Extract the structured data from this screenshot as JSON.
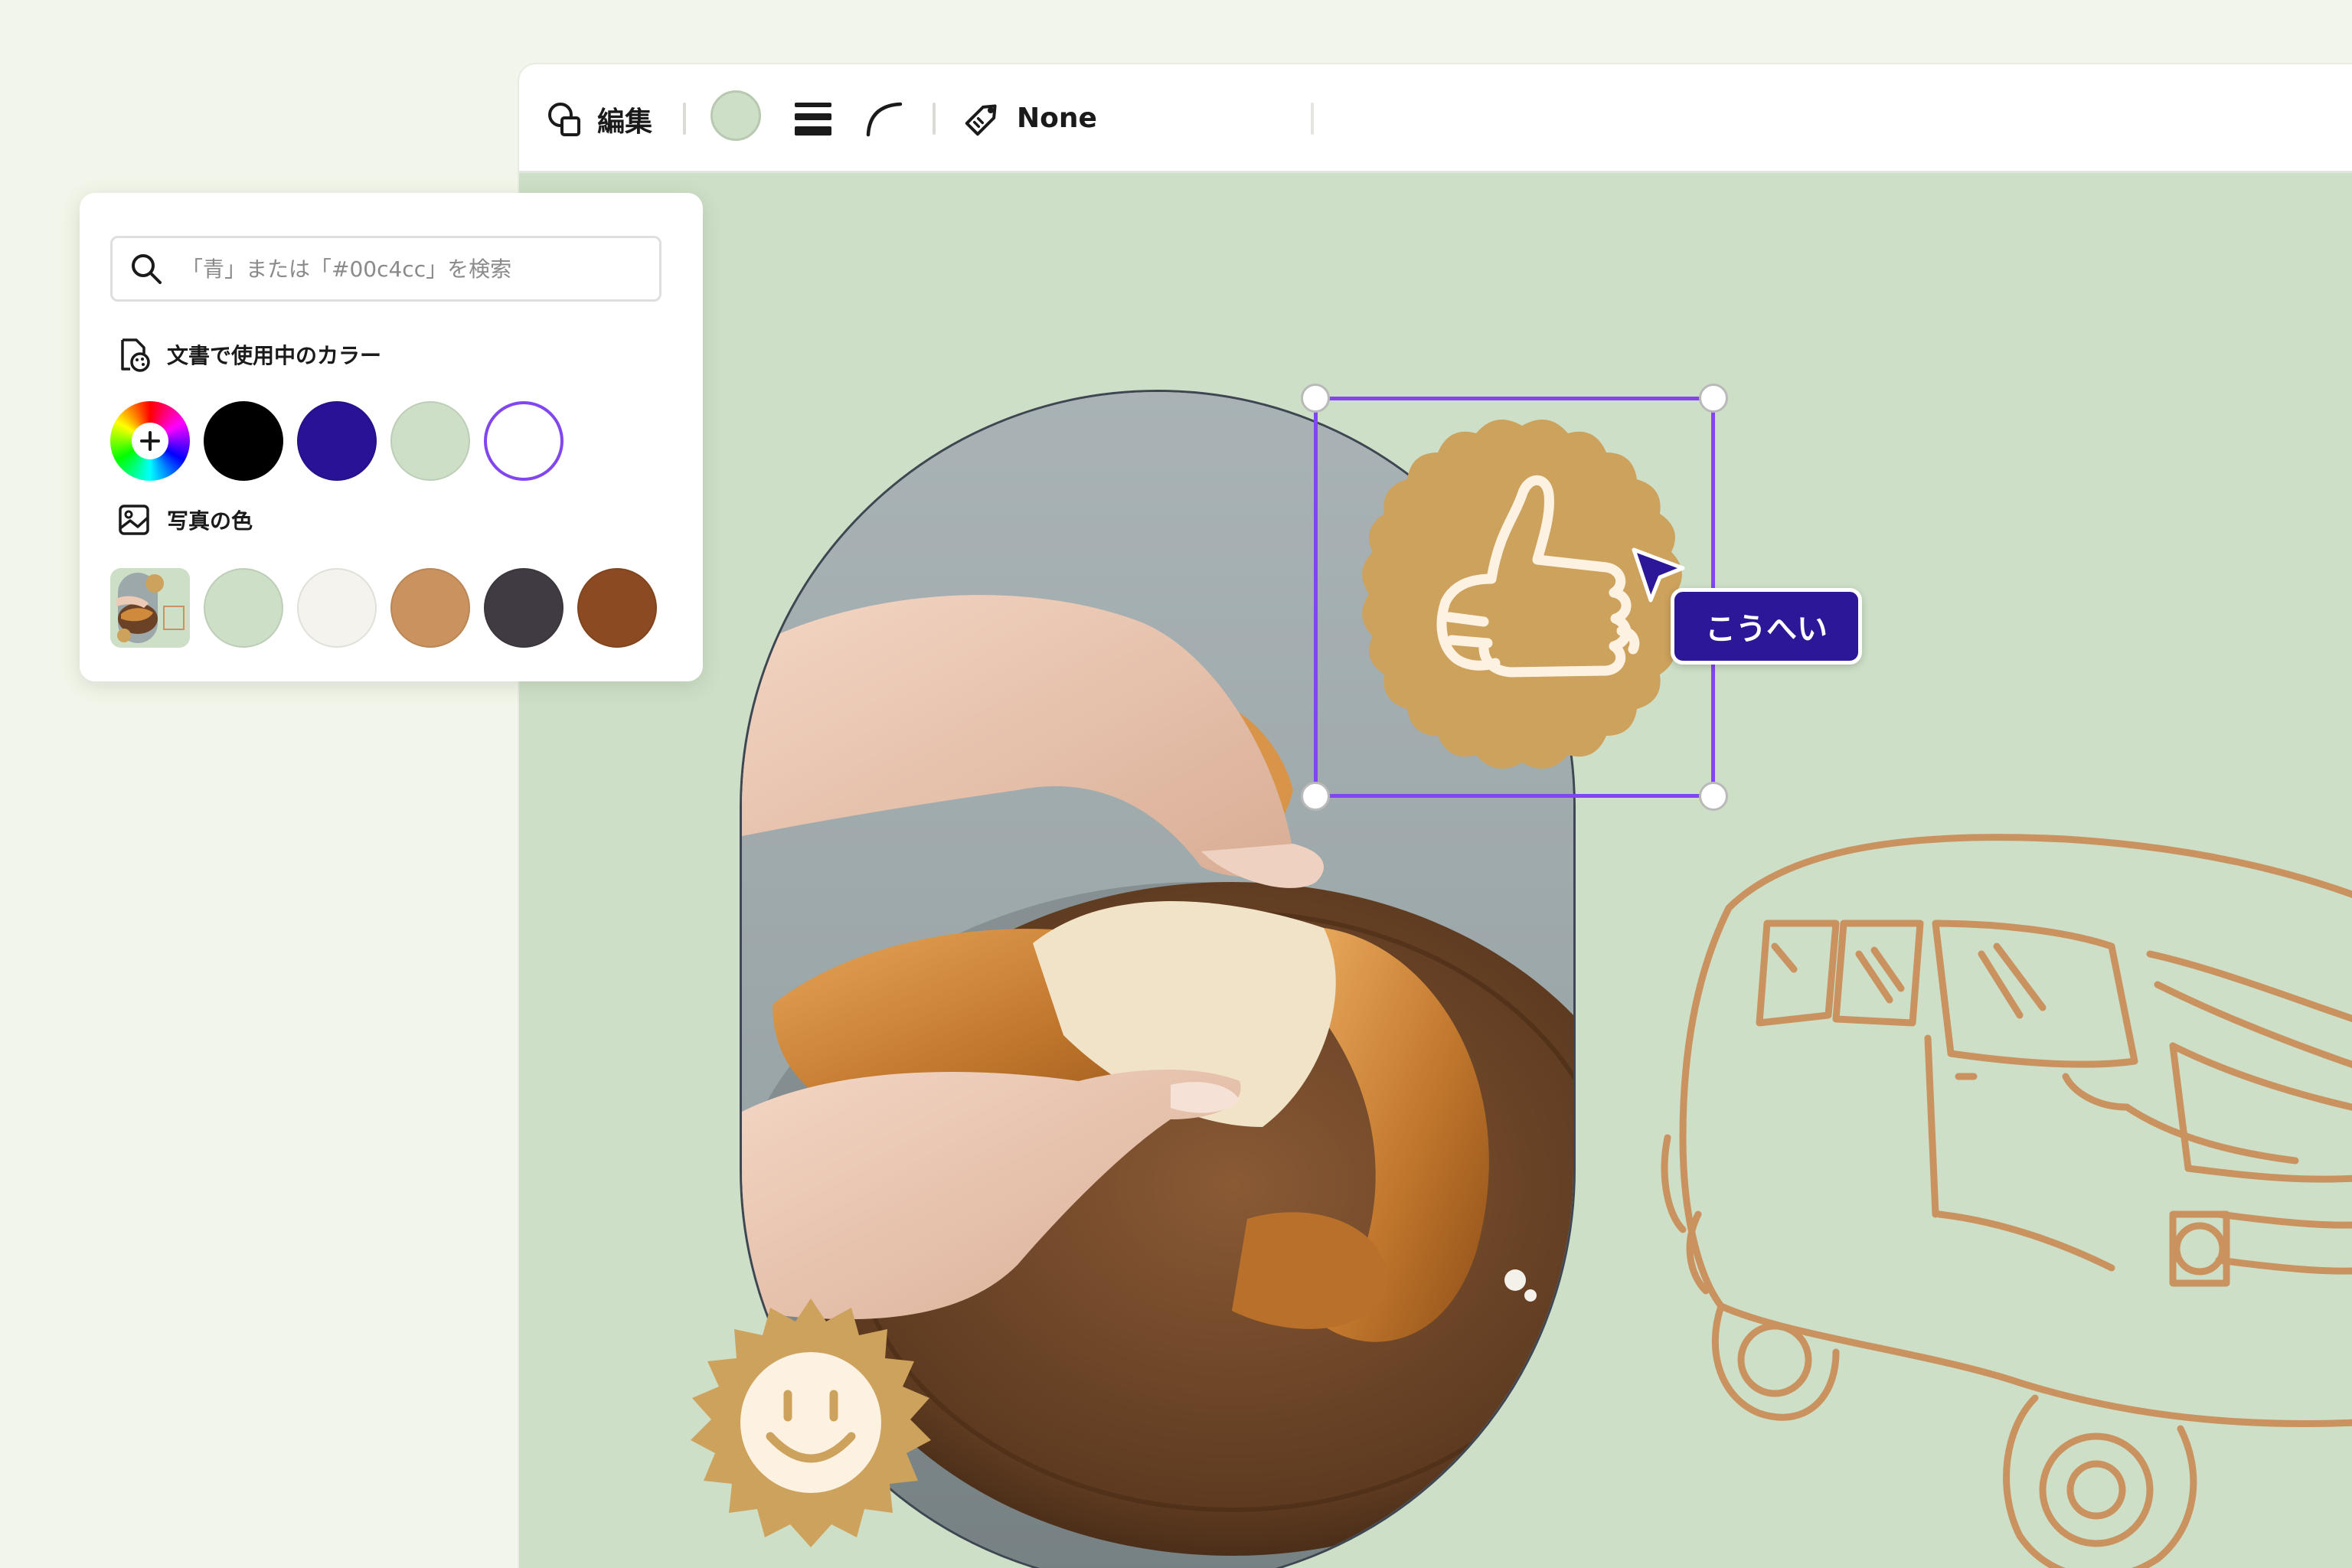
{
  "toolbar": {
    "edit_label": "編集",
    "current_color": "#cedfc7",
    "tag_label": "None"
  },
  "color_panel": {
    "search": {
      "placeholder": "「青」または「#00c4cc」を検索",
      "value": ""
    },
    "document_colors": {
      "title": "文書で使用中のカラー",
      "swatches": [
        "#000000",
        "#2a1296",
        "#cedfc7",
        "#ffffff"
      ]
    },
    "photo_colors": {
      "title": "写真の色",
      "swatches": [
        "#cedfc7",
        "#f4f3ee",
        "#c9925f",
        "#403b42",
        "#8b4a22"
      ]
    }
  },
  "canvas": {
    "background": "#cedfc7",
    "sticker_color": "#cda25d",
    "line_art_color": "#c9925f",
    "selection_color": "#8146f0"
  },
  "collaborator": {
    "name": "こうへい",
    "color": "#2c1798"
  }
}
